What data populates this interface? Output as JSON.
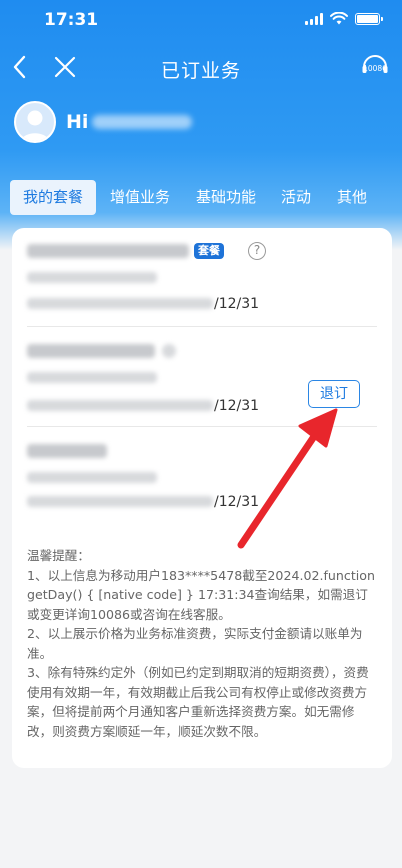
{
  "status_bar": {
    "time": "17:31"
  },
  "nav": {
    "title": "已订业务",
    "service_label": "10086"
  },
  "user": {
    "greeting": "Hi"
  },
  "tabs": [
    {
      "label": "我的套餐",
      "active": true
    },
    {
      "label": "增值业务",
      "active": false
    },
    {
      "label": "基础功能",
      "active": false
    },
    {
      "label": "活动",
      "active": false
    },
    {
      "label": "其他",
      "active": false
    }
  ],
  "items": [
    {
      "badge": "套餐",
      "date_tail": "/12/31",
      "help": "?"
    },
    {
      "date_tail": "/12/31",
      "unsubscribe_label": "退订"
    },
    {
      "date_tail": "/12/31"
    }
  ],
  "tips": {
    "title": "温馨提醒：",
    "lines": [
      "1、以上信息为移动用户183****5478截至2024.02.function getDay() { [native code] } 17:31:34查询结果，如需退订或变更详询10086或咨询在线客服。",
      "2、以上展示价格为业务标准资费，实际支付金额请以账单为准。",
      "3、除有特殊约定外（例如已约定到期取消的短期资费），资费使用有效期一年，有效期截止后我公司有权停止或修改资费方案，但将提前两个月通知客户重新选择资费方案。如无需修改，则资费方案顺延一年，顺延次数不限。"
    ]
  },
  "colors": {
    "brand": "#1f8cf0",
    "accent": "#1e7be0",
    "arrow": "#e8262c"
  }
}
